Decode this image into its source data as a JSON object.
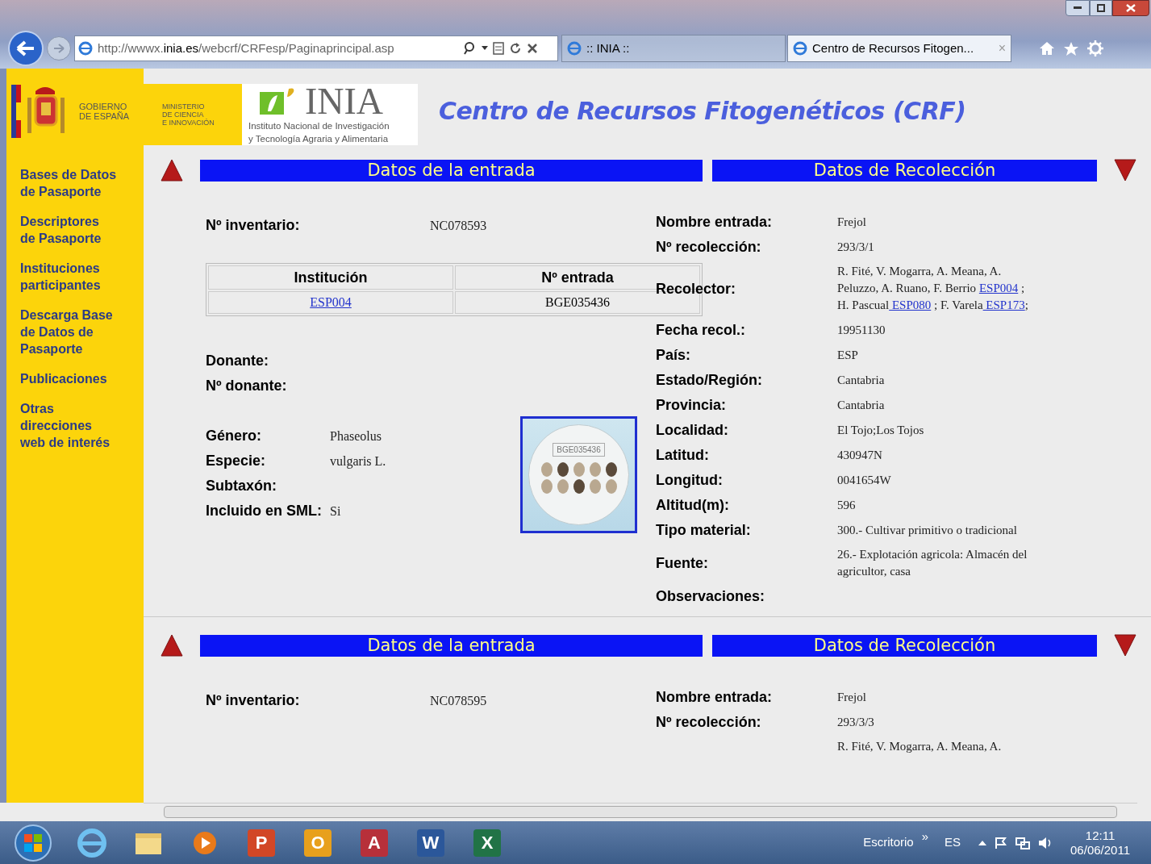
{
  "browser": {
    "url_parts": [
      {
        "text": "http://wwwx.",
        "strong": false
      },
      {
        "text": "inia.es",
        "strong": true
      },
      {
        "text": "/webcrf/CRFesp/Paginaprincipal.asp",
        "strong": false
      }
    ],
    "tabs": [
      {
        "title": ":: INIA ::",
        "selected": false
      },
      {
        "title": "Centro de Recursos Fitogen...",
        "selected": true
      }
    ],
    "tab_close": "×"
  },
  "header": {
    "gov": [
      "GOBIERNO",
      "DE ESPAÑA"
    ],
    "ministry": [
      "MINISTERIO",
      "DE CIENCIA",
      "E INNOVACIÓN"
    ],
    "inia": "INIA",
    "inia_subtitle": [
      "Instituto Nacional de Investigación",
      "y Tecnología Agraria y Alimentaria"
    ],
    "title": "Centro de Recursos Fitogenéticos (CRF)"
  },
  "sidebar": {
    "items": [
      {
        "lines": [
          "Bases de Datos",
          "de Pasaporte"
        ]
      },
      {
        "lines": [
          "Descriptores",
          "de Pasaporte"
        ]
      },
      {
        "lines": [
          "Instituciones",
          "participantes"
        ]
      },
      {
        "lines": [
          "Descarga Base",
          "de Datos de",
          "Pasaporte"
        ]
      },
      {
        "lines": [
          "Publicaciones"
        ]
      },
      {
        "lines": [
          "Otras",
          "direcciones",
          "web de interés"
        ]
      }
    ]
  },
  "records": [
    {
      "entry_heading": "Datos de la entrada",
      "collection_heading": "Datos de Recolección",
      "inventory": {
        "label": "Nº inventario:",
        "value": "NC078593"
      },
      "table": {
        "columns": [
          "Institución",
          "Nº entrada"
        ],
        "rows": [
          [
            {
              "text": "ESP004",
              "link": true
            },
            {
              "text": "BGE035436",
              "link": false
            }
          ]
        ]
      },
      "donor_fields": [
        {
          "label": "Donante:"
        },
        {
          "label": "Nº donante:"
        }
      ],
      "taxon_fields": [
        {
          "label": "Género:",
          "value": "Phaseolus"
        },
        {
          "label": "Especie:",
          "value": "vulgaris L."
        },
        {
          "label": "Subtaxón:"
        },
        {
          "label": "Incluido en SML:",
          "value": "Si"
        }
      ],
      "photo": {
        "caption": "BGE035436"
      },
      "collection_fields": [
        {
          "label": "Nombre entrada:",
          "parts": [
            {
              "text": "Frejol",
              "link": false
            }
          ]
        },
        {
          "label": "Nº recolección:",
          "parts": [
            {
              "text": "293/3/1",
              "link": false
            }
          ]
        },
        {
          "label": "Recolector:",
          "parts": [
            {
              "text": "R. Fité, V. Mogarra, A. Meana, A. Peluzzo, A. Ruano, F. Berrio ",
              "link": false
            },
            {
              "text": " ESP004",
              "link": true
            },
            {
              "text": " ; H. Pascual",
              "link": false
            },
            {
              "text": " ESP080",
              "link": true
            },
            {
              "text": " ; F. Varela",
              "link": false
            },
            {
              "text": " ESP173",
              "link": true
            },
            {
              "text": ";",
              "link": false
            }
          ]
        },
        {
          "label": "Fecha recol.:",
          "parts": [
            {
              "text": "19951130",
              "link": false
            }
          ]
        },
        {
          "label": "País:",
          "parts": [
            {
              "text": "ESP",
              "link": false
            }
          ]
        },
        {
          "label": "Estado/Región:",
          "parts": [
            {
              "text": "Cantabria",
              "link": false
            }
          ]
        },
        {
          "label": "Provincia:",
          "parts": [
            {
              "text": "Cantabria",
              "link": false
            }
          ]
        },
        {
          "label": "Localidad:",
          "parts": [
            {
              "text": "El Tojo;Los Tojos",
              "link": false
            }
          ]
        },
        {
          "label": "Latitud:",
          "parts": [
            {
              "text": "430947N",
              "link": false
            }
          ]
        },
        {
          "label": "Longitud:",
          "parts": [
            {
              "text": "0041654W",
              "link": false
            }
          ]
        },
        {
          "label": "Altitud(m):",
          "parts": [
            {
              "text": "596",
              "link": false
            }
          ]
        },
        {
          "label": "Tipo material:",
          "parts": [
            {
              "text": "300.- Cultivar primitivo o tradicional",
              "link": false
            }
          ]
        },
        {
          "label": "Fuente:",
          "parts": [
            {
              "text": "26.- Explotación agricola: Almacén del agricultor, casa",
              "link": false
            }
          ]
        },
        {
          "label": "Observaciones:"
        }
      ]
    },
    {
      "entry_heading": "Datos de la entrada",
      "collection_heading": "Datos de Recolección",
      "inventory": {
        "label": "Nº inventario:",
        "value": "NC078595"
      },
      "collection_fields": [
        {
          "label": "Nombre entrada:",
          "parts": [
            {
              "text": "Frejol",
              "link": false
            }
          ]
        },
        {
          "label": "Nº recolección:",
          "parts": [
            {
              "text": "293/3/3",
              "link": false
            }
          ]
        },
        {
          "parts": [
            {
              "text": "R. Fité, V. Mogarra, A. Meana, A.",
              "link": false
            }
          ]
        }
      ]
    }
  ],
  "taskbar": {
    "apps": [
      {
        "glyph": "P",
        "color": "#d24726"
      },
      {
        "glyph": "O",
        "color": "#e8a01c"
      },
      {
        "glyph": "A",
        "color": "#b7303a"
      },
      {
        "glyph": "W",
        "color": "#2b579a"
      },
      {
        "glyph": "X",
        "color": "#217346"
      }
    ],
    "desktop": "Escritorio",
    "chevron": "»",
    "language": "ES",
    "time": "12:11",
    "date": "06/06/2011"
  }
}
